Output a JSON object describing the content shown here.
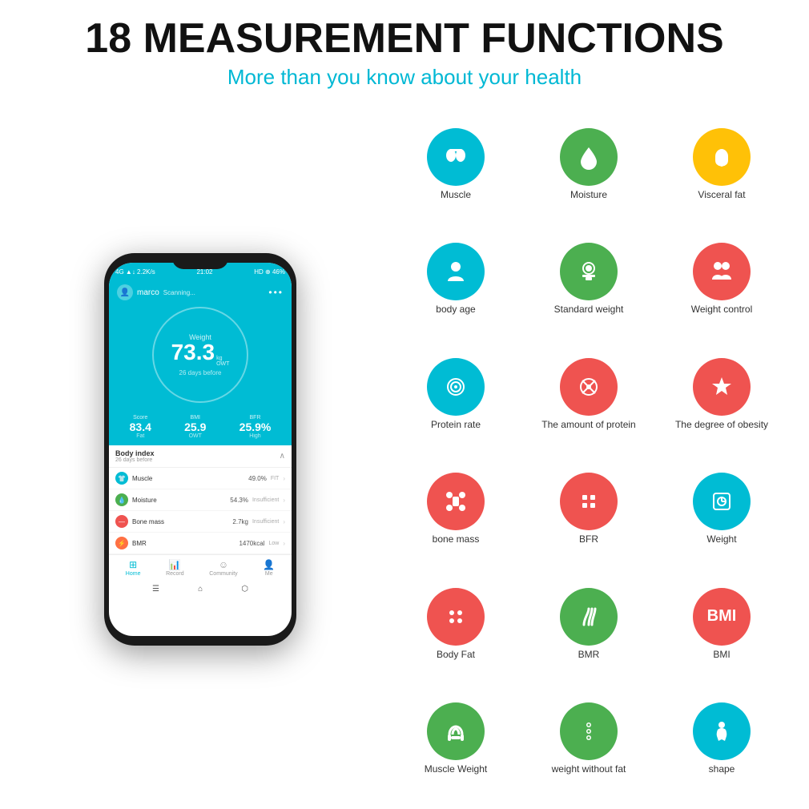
{
  "header": {
    "main_title": "18 MEASUREMENT FUNCTIONS",
    "sub_title": "More than you know about your health"
  },
  "phone": {
    "status_bar": {
      "left": "4G ▲↓ 2.2K/s",
      "time": "21:02",
      "right": "HD ⊕ 46%"
    },
    "user": "marco",
    "scanning": "Scanning...",
    "weight_label": "Weight",
    "weight_value": "73.3",
    "weight_unit": "kg OWT",
    "weight_days": "26 days before",
    "stats": [
      {
        "label": "Score",
        "value": "83.4",
        "sub": "Fat"
      },
      {
        "label": "BMI",
        "value": "25.9",
        "sub": "OWT"
      },
      {
        "label": "BFR",
        "value": "25.9%",
        "sub": "High"
      }
    ],
    "body_index": {
      "title": "Body index",
      "sub": "26 days before"
    },
    "list_items": [
      {
        "name": "Muscle",
        "value": "49.0%",
        "status": "FIT",
        "color": "#00bcd4",
        "icon": "👕"
      },
      {
        "name": "Moisture",
        "value": "54.3%",
        "status": "Insufficient",
        "color": "#4caf50",
        "icon": "💧"
      },
      {
        "name": "Bone mass",
        "value": "2.7kg",
        "status": "Insufficient",
        "color": "#ef5350",
        "icon": "—"
      },
      {
        "name": "BMR",
        "value": "1470kcal",
        "status": "Low",
        "color": "#ff7043",
        "icon": "⚡"
      }
    ],
    "nav": [
      {
        "label": "Home",
        "active": true,
        "icon": "⊞"
      },
      {
        "label": "Record",
        "active": false,
        "icon": "📊"
      },
      {
        "label": "Community",
        "active": false,
        "icon": "☺"
      },
      {
        "label": "Me",
        "active": false,
        "icon": "👤"
      }
    ]
  },
  "features": [
    {
      "label": "Muscle",
      "color": "teal",
      "icon": "💪"
    },
    {
      "label": "Moisture",
      "color": "green",
      "icon": "💧"
    },
    {
      "label": "Visceral fat",
      "color": "yellow",
      "icon": "🫁"
    },
    {
      "label": "body age",
      "color": "teal",
      "icon": "🧑"
    },
    {
      "label": "Standard weight",
      "color": "green",
      "icon": "⚖"
    },
    {
      "label": "Weight control",
      "color": "pink",
      "icon": "👥"
    },
    {
      "label": "Protein rate",
      "color": "teal",
      "icon": "✿"
    },
    {
      "label": "The amount of protein",
      "color": "pink",
      "icon": "❋"
    },
    {
      "label": "The degree of obesity",
      "color": "pink",
      "icon": "⭐"
    },
    {
      "label": "bone mass",
      "color": "pink",
      "icon": "🦴"
    },
    {
      "label": "BFR",
      "color": "pink",
      "icon": "✦"
    },
    {
      "label": "Weight",
      "color": "teal",
      "icon": "⊡"
    },
    {
      "label": "Body Fat",
      "color": "pink",
      "icon": "✦"
    },
    {
      "label": "BMR",
      "color": "green",
      "icon": "≋"
    },
    {
      "label": "BMI",
      "color": "pink",
      "icon": "BMI"
    },
    {
      "label": "Muscle Weight",
      "color": "green",
      "icon": "💪"
    },
    {
      "label": "weight without fat",
      "color": "green",
      "icon": "◎"
    },
    {
      "label": "shape",
      "color": "teal",
      "icon": "🧍"
    }
  ]
}
